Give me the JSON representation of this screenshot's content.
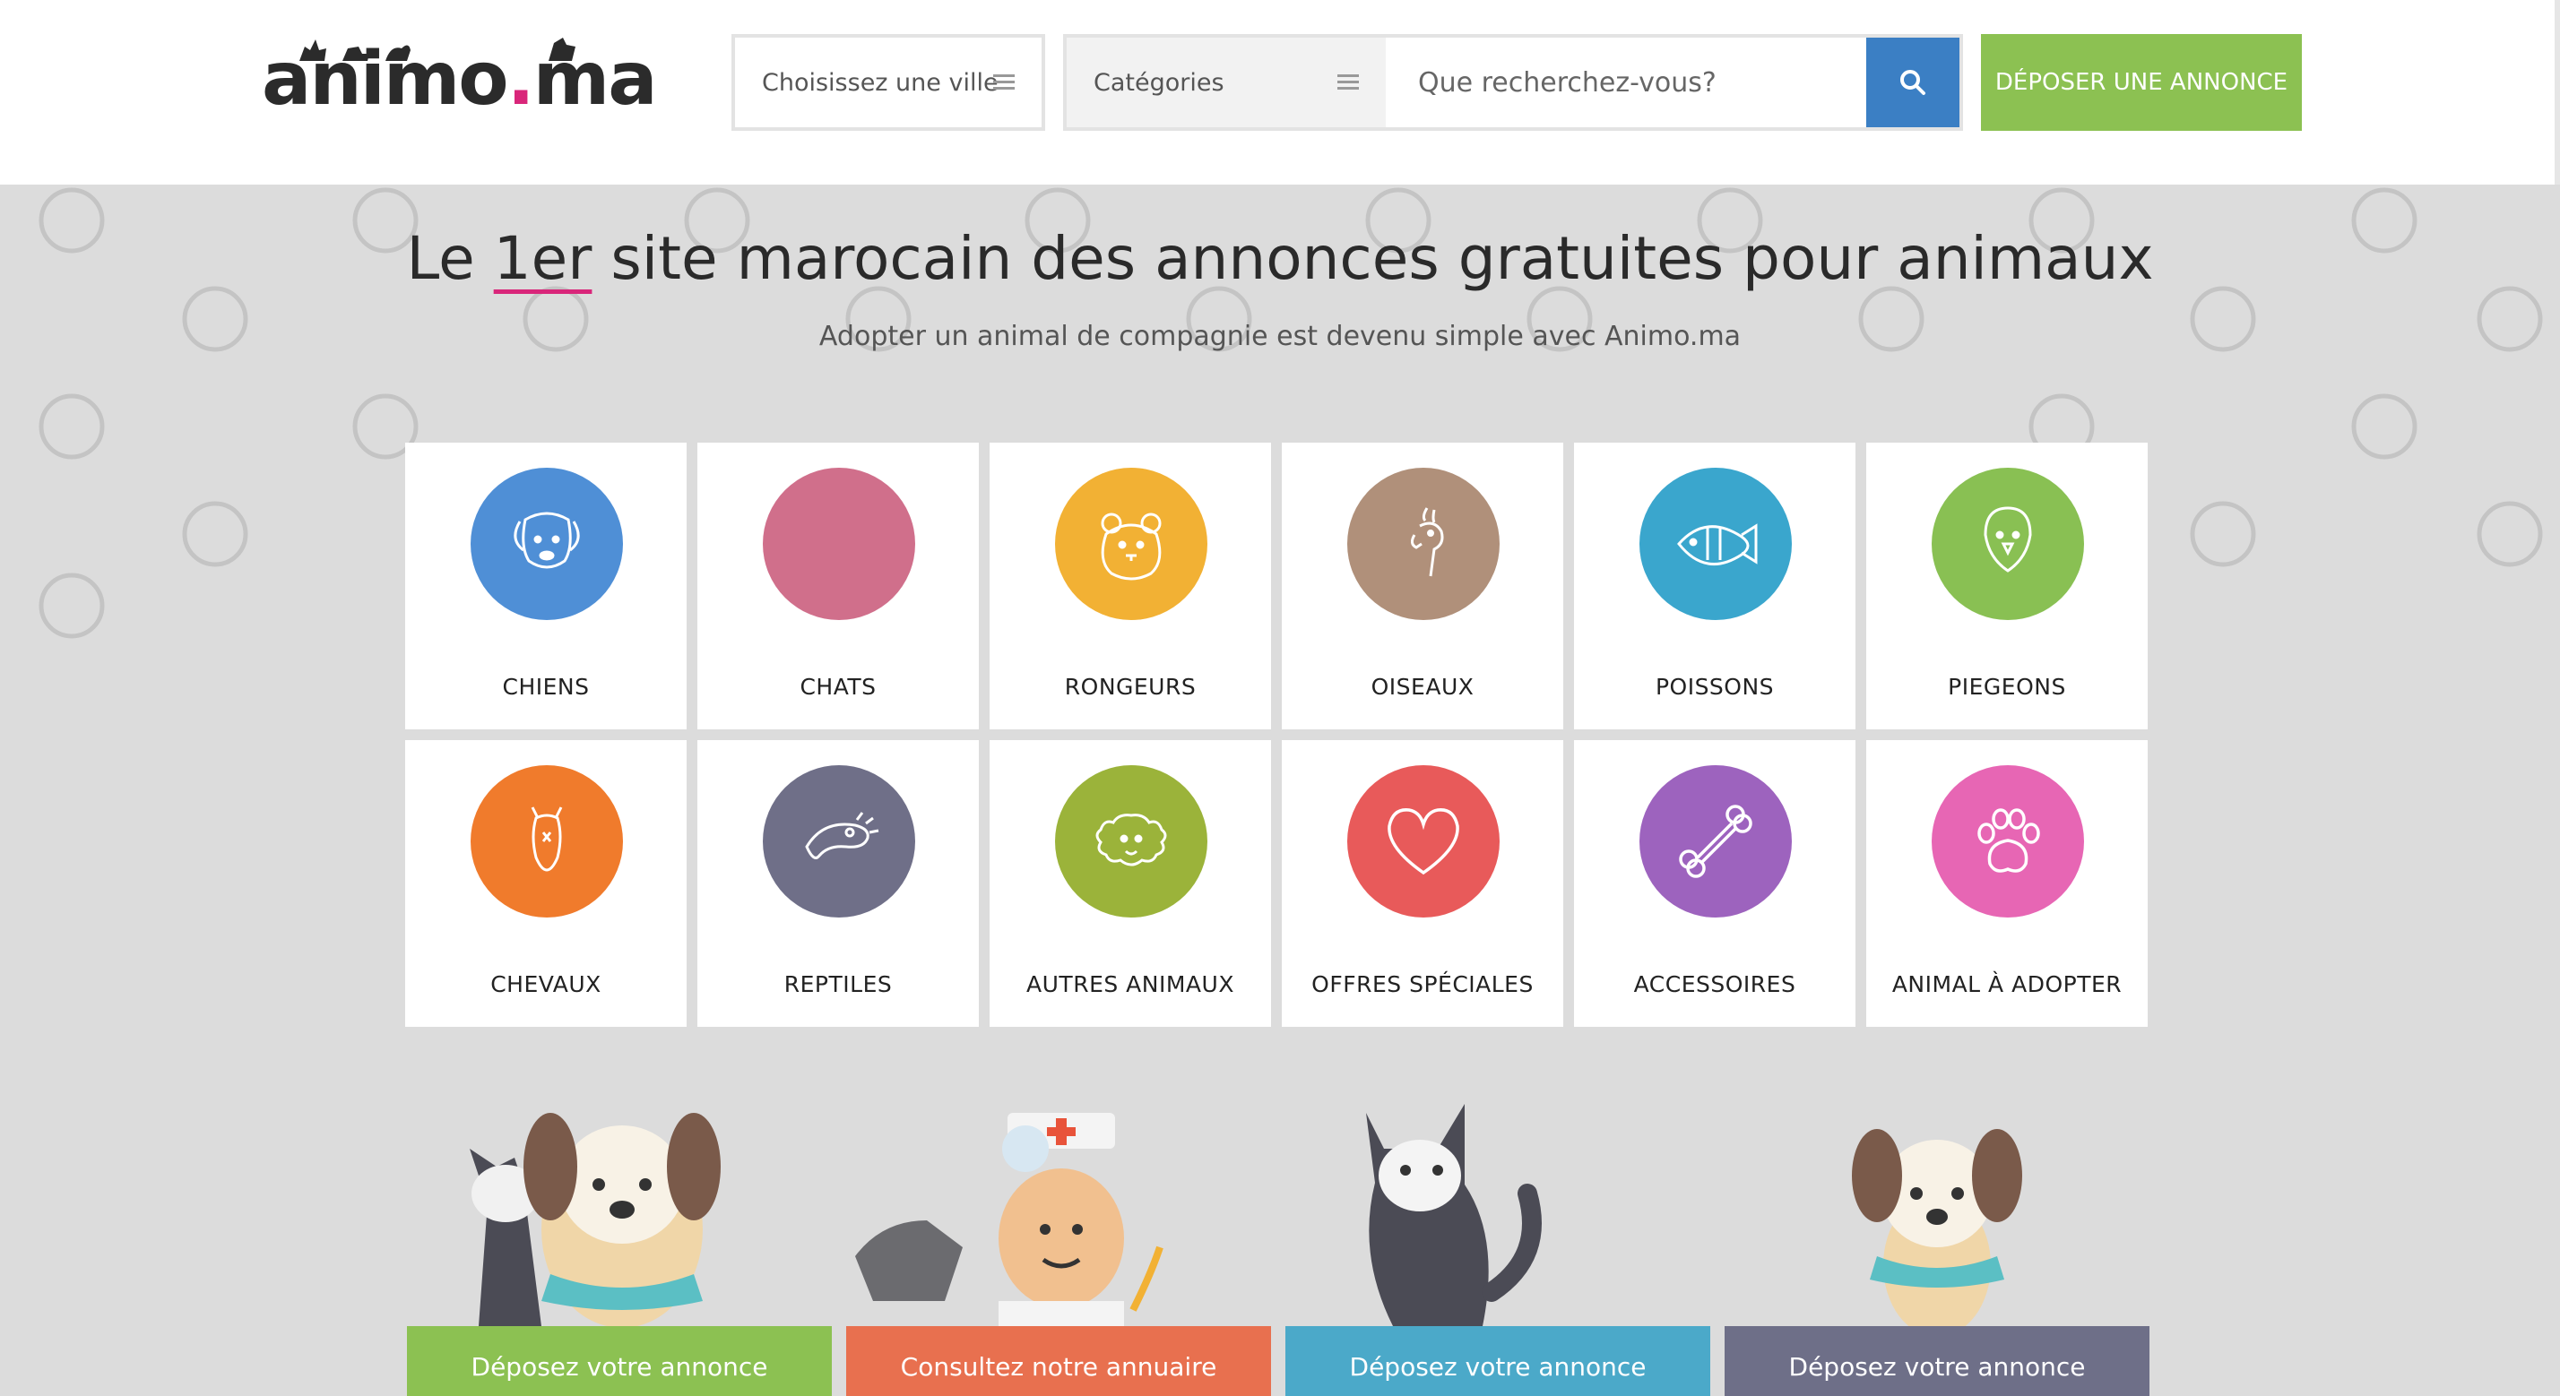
{
  "header": {
    "logo_text": "animo",
    "logo_dot": ".",
    "logo_suffix": "ma",
    "city_select_label": "Choisissez une ville",
    "category_select_label": "Catégories",
    "search_placeholder": "Que recherchez-vous?",
    "post_button_label": "DÉPOSER UNE ANNONCE"
  },
  "hero": {
    "title_before": "Le ",
    "title_highlight": "1er",
    "title_after": " site marocain des annonces gratuites pour animaux",
    "subtitle": "Adopter un animal de compagnie est devenu simple avec Animo.ma"
  },
  "categories": [
    {
      "label": "CHIENS",
      "color": "#4f8fd6",
      "icon": "dog-icon"
    },
    {
      "label": "CHATS",
      "color": "#d06f8b",
      "icon": "cat-icon"
    },
    {
      "label": "RONGEURS",
      "color": "#f2b134",
      "icon": "hamster-icon"
    },
    {
      "label": "OISEAUX",
      "color": "#b0907a",
      "icon": "cockatoo-icon"
    },
    {
      "label": "POISSONS",
      "color": "#3aa6cd",
      "icon": "fish-icon"
    },
    {
      "label": "PIEGEONS",
      "color": "#89c053",
      "icon": "pigeon-icon"
    },
    {
      "label": "CHEVAUX",
      "color": "#f07b2c",
      "icon": "horse-icon"
    },
    {
      "label": "REPTILES",
      "color": "#6f6f88",
      "icon": "lizard-icon"
    },
    {
      "label": "AUTRES ANIMAUX",
      "color": "#9bb33a",
      "icon": "sheep-icon"
    },
    {
      "label": "OFFRES SPÉCIALES",
      "color": "#e85a5a",
      "icon": "heart-icon"
    },
    {
      "label": "ACCESSOIRES",
      "color": "#9d63be",
      "icon": "bone-icon"
    },
    {
      "label": "ANIMAL À ADOPTER",
      "color": "#e766b4",
      "icon": "paw-icon"
    }
  ],
  "tiles": [
    {
      "label": "Déposez votre annonce",
      "color": "#8cc152"
    },
    {
      "label": "Consultez notre annuaire",
      "color": "#e8704f"
    },
    {
      "label": "Déposez votre annonce",
      "color": "#4ba9c9"
    },
    {
      "label": "Déposez votre annonce",
      "color": "#6e6f88"
    }
  ]
}
